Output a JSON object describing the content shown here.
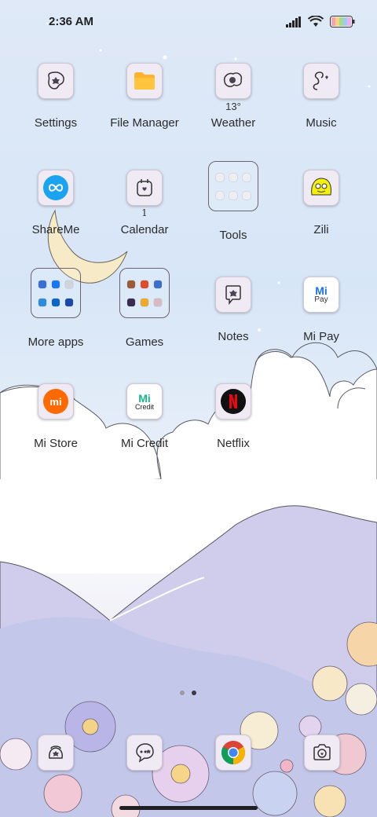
{
  "status_bar": {
    "time": "2:36 AM"
  },
  "apps": {
    "settings": "Settings",
    "file_manager": "File Manager",
    "weather": "Weather",
    "weather_temp": "13°",
    "music": "Music",
    "shareme": "ShareMe",
    "calendar": "Calendar",
    "calendar_day": "1",
    "tools": "Tools",
    "zili": "Zili",
    "more_apps": "More apps",
    "games": "Games",
    "notes": "Notes",
    "mi_pay": "Mi Pay",
    "mi_pay_icon_text": "Pay",
    "mi_store": "Mi Store",
    "mi_credit": "Mi Credit",
    "mi_credit_icon_text": "Credit",
    "netflix": "Netflix"
  },
  "page_indicator": {
    "current": 2,
    "total": 2
  },
  "dock": [
    "phone-icon",
    "messages-icon",
    "chrome-icon",
    "camera-icon"
  ],
  "colors": {
    "sky": "#dbe7f6",
    "moon": "#f6ecc8",
    "mountain": "#c9c7e6",
    "shareme_blue": "#1aa3f0",
    "mi_orange": "#ff6a00",
    "netflix_red": "#e50914",
    "mi_green": "#14b88a"
  }
}
